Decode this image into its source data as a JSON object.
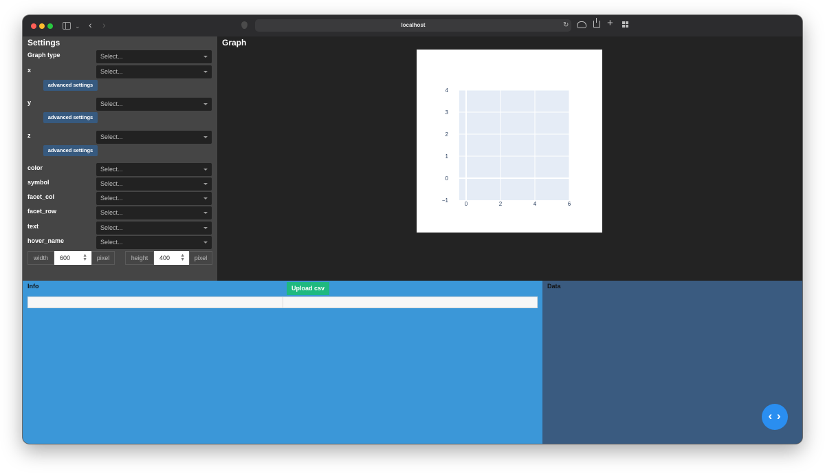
{
  "browser": {
    "url": "localhost"
  },
  "settings": {
    "title": "Settings",
    "select_placeholder": "Select...",
    "advanced_label": "advanced settings",
    "fields": {
      "graph_type": "Graph type",
      "x": "x",
      "y": "y",
      "z": "z",
      "color": "color",
      "symbol": "symbol",
      "facet_col": "facet_col",
      "facet_row": "facet_row",
      "text": "text",
      "hover_name": "hover_name"
    },
    "width_label": "width",
    "width_value": "600",
    "height_label": "height",
    "height_value": "400",
    "unit": "pixel"
  },
  "graph": {
    "title": "Graph",
    "chart_data": {
      "type": "scatter",
      "x_ticks": [
        "0",
        "2",
        "4",
        "6"
      ],
      "y_ticks": [
        "4",
        "3",
        "2",
        "1",
        "0",
        "−1"
      ],
      "xlim": [
        -0.4,
        6
      ],
      "ylim": [
        -1,
        4
      ],
      "values": [],
      "grid": true
    }
  },
  "info": {
    "title": "Info",
    "upload_label": "Upload csv"
  },
  "data_panel": {
    "title": "Data"
  },
  "icons": {
    "code": "‹ ›"
  },
  "colors": {
    "info_bg": "#3b97d8",
    "data_bg": "#3a5b80",
    "accent_button": "#375a7f",
    "upload_button": "#1fb980"
  }
}
